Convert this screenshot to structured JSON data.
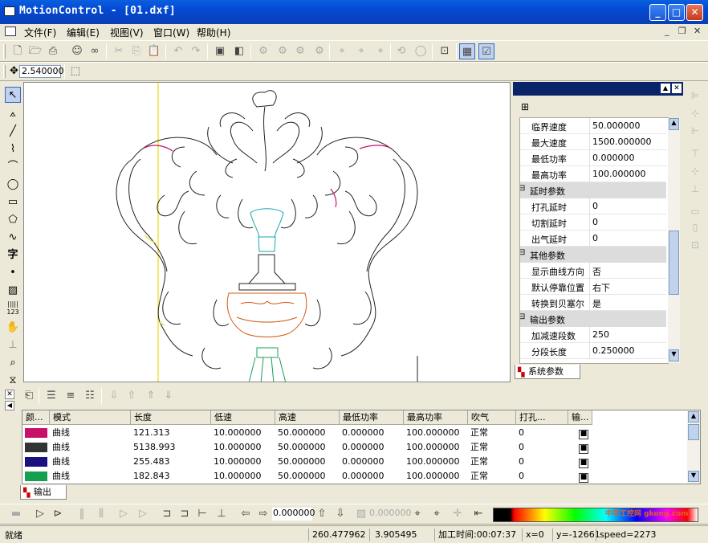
{
  "window": {
    "title": "MotionControl - [01.dxf]",
    "min": "_",
    "max": "□",
    "close": "✕"
  },
  "menu": [
    "文件(F)",
    "编辑(E)",
    "视图(V)",
    "窗口(W)",
    "帮助(H)"
  ],
  "mdi": {
    "min": "_",
    "restore": "❐",
    "close": "✕"
  },
  "toolbar2": {
    "value": "2.540000"
  },
  "properties": {
    "rows": [
      {
        "type": "row",
        "k": "临界速度",
        "v": "50.000000"
      },
      {
        "type": "row",
        "k": "最大速度",
        "v": "1500.000000"
      },
      {
        "type": "row",
        "k": "最低功率",
        "v": "0.000000"
      },
      {
        "type": "row",
        "k": "最高功率",
        "v": "100.000000"
      },
      {
        "type": "cat",
        "k": "延时参数"
      },
      {
        "type": "row",
        "k": "打孔延时",
        "v": "0"
      },
      {
        "type": "row",
        "k": "切割延时",
        "v": "0"
      },
      {
        "type": "row",
        "k": "出气延时",
        "v": "0"
      },
      {
        "type": "cat",
        "k": "其他参数"
      },
      {
        "type": "row",
        "k": "显示曲线方向",
        "v": "否"
      },
      {
        "type": "row",
        "k": "默认停靠位置",
        "v": "右下"
      },
      {
        "type": "row",
        "k": "转换到贝塞尔",
        "v": "是"
      },
      {
        "type": "cat",
        "k": "输出参数"
      },
      {
        "type": "row",
        "k": "加减速段数",
        "v": "250"
      },
      {
        "type": "row",
        "k": "分段长度",
        "v": "0.250000"
      }
    ],
    "tab": "系统参数"
  },
  "table": {
    "headers": [
      "颜...",
      "模式",
      "长度",
      "低速",
      "高速",
      "最低功率",
      "最高功率",
      "吹气",
      "打孔...",
      "输..."
    ],
    "rows": [
      {
        "color": "#c8106a",
        "mode": "曲线",
        "len": "121.313",
        "low": "10.000000",
        "high": "50.000000",
        "minp": "0.000000",
        "maxp": "100.000000",
        "air": "正常",
        "hole": "0"
      },
      {
        "color": "#333333",
        "mode": "曲线",
        "len": "5138.993",
        "low": "10.000000",
        "high": "50.000000",
        "minp": "0.000000",
        "maxp": "100.000000",
        "air": "正常",
        "hole": "0"
      },
      {
        "color": "#1a1080",
        "mode": "曲线",
        "len": "255.483",
        "low": "10.000000",
        "high": "50.000000",
        "minp": "0.000000",
        "maxp": "100.000000",
        "air": "正常",
        "hole": "0"
      },
      {
        "color": "#15a050",
        "mode": "曲线",
        "len": "182.843",
        "low": "10.000000",
        "high": "50.000000",
        "minp": "0.000000",
        "maxp": "100.000000",
        "air": "正常",
        "hole": "0"
      }
    ],
    "tab": "输出"
  },
  "bottomtb": {
    "value1": "0.000000",
    "value2": "0.000000"
  },
  "status": {
    "ready": "就绪",
    "x": "260.477962",
    "y": "3.905495",
    "time": "加工时间:00:07:37",
    "xpos": "x=0",
    "ypos": "y=-12661",
    "speed": "speed=2273"
  },
  "watermark": "中华工控网 gkong.com"
}
